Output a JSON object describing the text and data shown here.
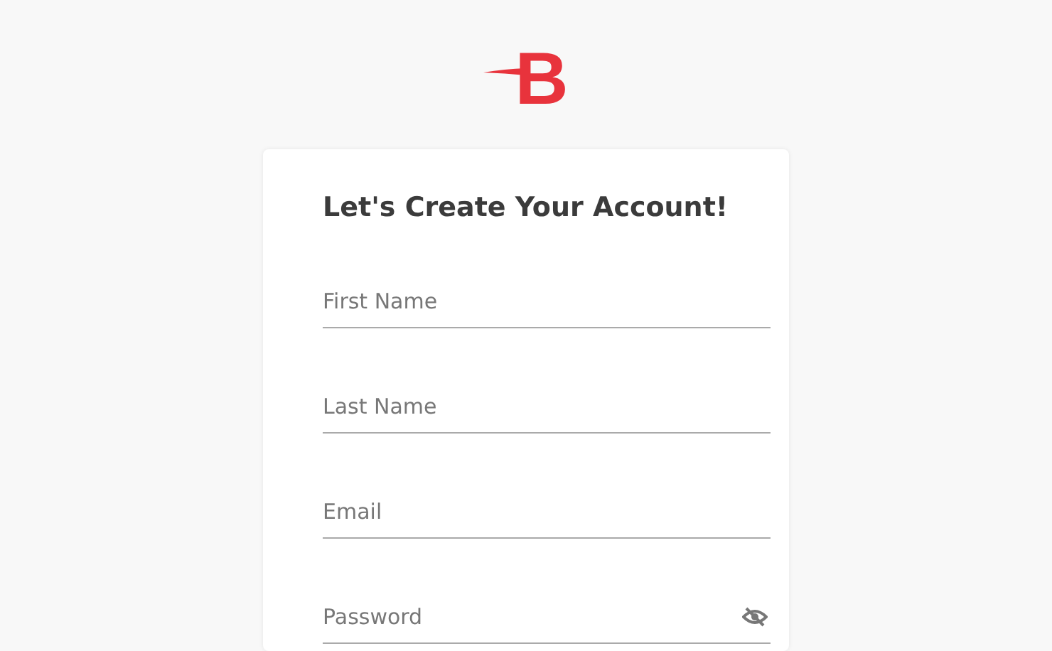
{
  "logo": {
    "text": "B"
  },
  "form": {
    "title": "Let's Create Your Account!",
    "fields": [
      {
        "kind": "text",
        "placeholder": "First Name"
      },
      {
        "kind": "text",
        "placeholder": "Last Name"
      },
      {
        "kind": "email",
        "placeholder": "Email"
      },
      {
        "kind": "password",
        "placeholder": "Password"
      }
    ]
  }
}
